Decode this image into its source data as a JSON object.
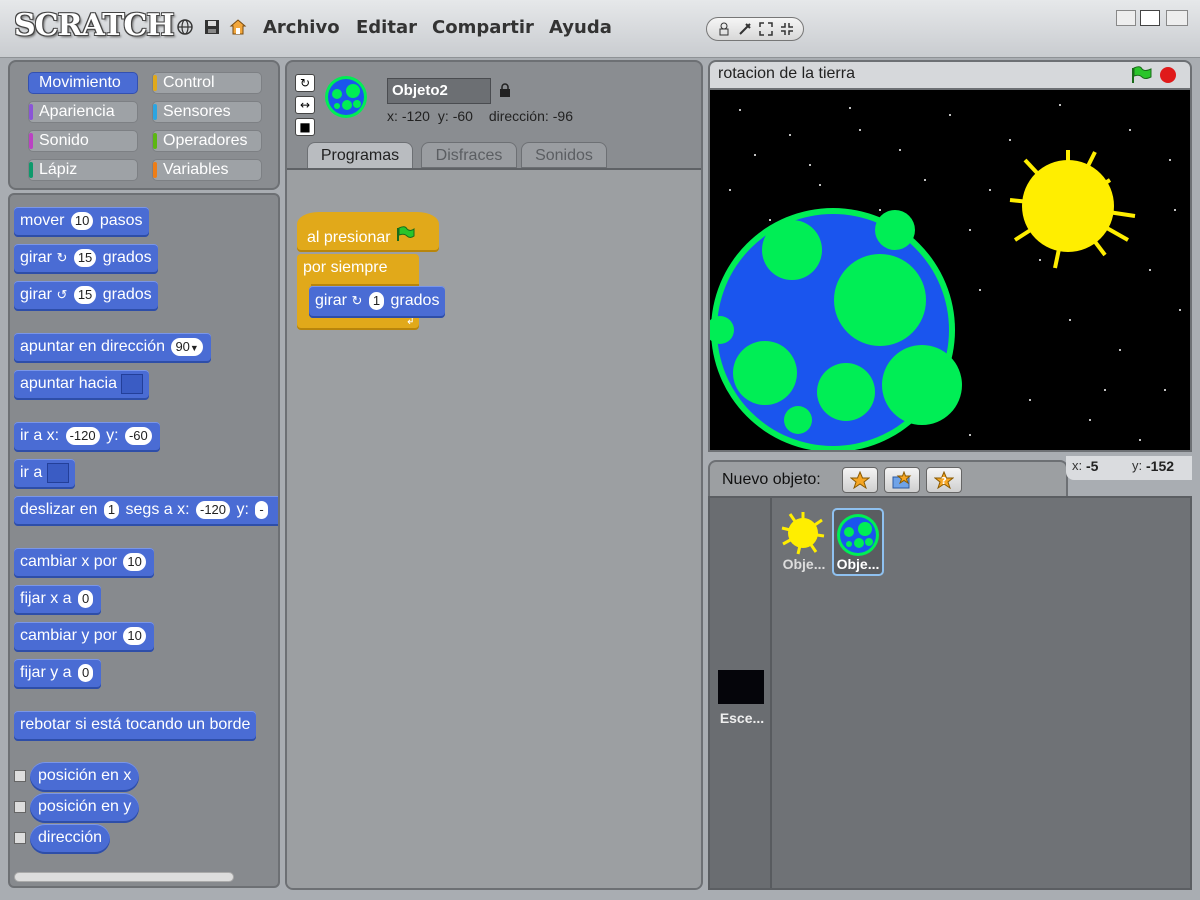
{
  "app": {
    "logo": "SCRATCH"
  },
  "menu": {
    "file": "Archivo",
    "edit": "Editar",
    "share": "Compartir",
    "help": "Ayuda"
  },
  "categories": {
    "motion": "Movimiento",
    "control": "Control",
    "looks": "Apariencia",
    "sensing": "Sensores",
    "sound": "Sonido",
    "operators": "Operadores",
    "pen": "Lápiz",
    "variables": "Variables",
    "colors": {
      "motion": "#4a6cd4",
      "control": "#e1a91a",
      "looks": "#8a55d7",
      "sensing": "#2ca5e2",
      "sound": "#bb42c3",
      "operators": "#5cb712",
      "pen": "#0e9a6c",
      "variables": "#ee7d16"
    }
  },
  "palette": {
    "move": {
      "pre": "mover",
      "n": "10",
      "post": "pasos"
    },
    "turn_cw": {
      "pre": "girar",
      "n": "15",
      "post": "grados"
    },
    "turn_ccw": {
      "pre": "girar",
      "n": "15",
      "post": "grados"
    },
    "point_dir": {
      "pre": "apuntar en dirección",
      "n": "90"
    },
    "point_towards": {
      "pre": "apuntar hacia"
    },
    "goto_xy": {
      "pre": "ir a x:",
      "x": "-120",
      "mid": "y:",
      "y": "-60"
    },
    "goto": {
      "pre": "ir a"
    },
    "glide": {
      "pre": "deslizar en",
      "n": "1",
      "mid": "segs a x:",
      "x": "-120",
      "mid2": "y:",
      "y": "-"
    },
    "change_x": {
      "pre": "cambiar x por",
      "n": "10"
    },
    "set_x": {
      "pre": "fijar x a",
      "n": "0"
    },
    "change_y": {
      "pre": "cambiar y por",
      "n": "10"
    },
    "set_y": {
      "pre": "fijar y a",
      "n": "0"
    },
    "bounce": "rebotar si está tocando un borde",
    "xpos": "posición en x",
    "ypos": "posición en y",
    "direction": "dirección"
  },
  "sprite": {
    "name": "Objeto2",
    "x_label": "x:",
    "x": "-120",
    "y_label": "y:",
    "y": "-60",
    "dir_label": "dirección:",
    "dir": "-96"
  },
  "tabs": {
    "scripts": "Programas",
    "costumes": "Disfraces",
    "sounds": "Sonidos"
  },
  "script": {
    "hat": "al presionar",
    "forever": "por siempre",
    "turn": {
      "pre": "girar",
      "n": "1",
      "post": "grados"
    }
  },
  "stage": {
    "title": "rotacion de la tierra"
  },
  "library": {
    "new_sprite": "Nuevo objeto:",
    "coords": {
      "x_label": "x:",
      "x": "-5",
      "y_label": "y:",
      "y": "-152"
    },
    "sprites": [
      {
        "label": "Obje..."
      },
      {
        "label": "Obje..."
      }
    ],
    "stage_label": "Esce..."
  }
}
